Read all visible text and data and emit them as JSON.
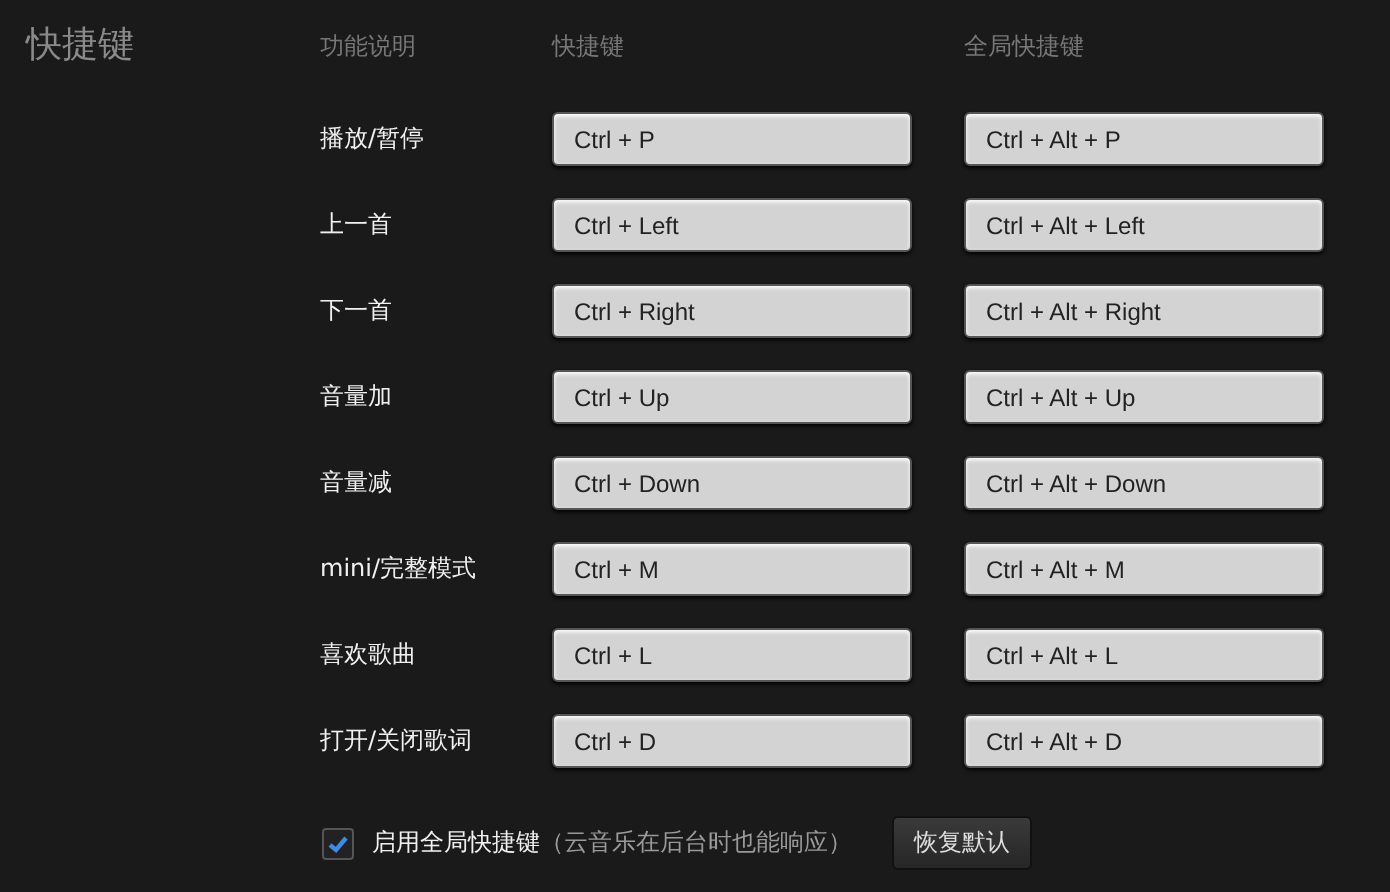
{
  "title": "快捷键",
  "columns": [
    "功能说明",
    "快捷键",
    "全局快捷键"
  ],
  "rows": [
    {
      "action": "播放/暂停",
      "shortcut": "Ctrl + P",
      "global_shortcut": "Ctrl + Alt + P"
    },
    {
      "action": "上一首",
      "shortcut": "Ctrl + Left",
      "global_shortcut": "Ctrl + Alt + Left"
    },
    {
      "action": "下一首",
      "shortcut": "Ctrl + Right",
      "global_shortcut": "Ctrl + Alt + Right"
    },
    {
      "action": "音量加",
      "shortcut": "Ctrl + Up",
      "global_shortcut": "Ctrl + Alt + Up"
    },
    {
      "action": "音量减",
      "shortcut": "Ctrl + Down",
      "global_shortcut": "Ctrl + Alt + Down"
    },
    {
      "action": "mini/完整模式",
      "shortcut": "Ctrl + M",
      "global_shortcut": "Ctrl + Alt + M"
    },
    {
      "action": "喜欢歌曲",
      "shortcut": "Ctrl + L",
      "global_shortcut": "Ctrl + Alt + L"
    },
    {
      "action": "打开/关闭歌词",
      "shortcut": "Ctrl + D",
      "global_shortcut": "Ctrl + Alt + D"
    }
  ],
  "global_toggle": {
    "label": "启用全局快捷键",
    "hint": "（云音乐在后台时也能响应）",
    "checked": true
  },
  "reset_button": "恢复默认"
}
